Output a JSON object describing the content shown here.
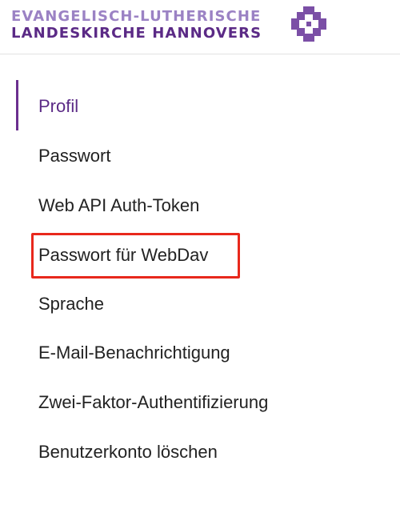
{
  "header": {
    "logo_line1": "EVANGELISCH-LUTHERISCHE",
    "logo_line2": "LANDESKIRCHE HANNOVERS",
    "logo_icon": "cross-icon",
    "colors": {
      "brand_light": "#9b82c4",
      "brand_dark": "#5b2a86"
    }
  },
  "nav": {
    "active_color": "#5b2a86",
    "highlight_color": "#e8281c",
    "items": [
      {
        "label": "Profil"
      },
      {
        "label": "Passwort"
      },
      {
        "label": "Web API Auth-Token"
      },
      {
        "label": "Passwort für WebDav"
      },
      {
        "label": "Sprache"
      },
      {
        "label": "E-Mail-Benachrichtigung"
      },
      {
        "label": "Zwei-Faktor-Authentifizierung"
      },
      {
        "label": "Benutzerkonto löschen"
      }
    ]
  }
}
